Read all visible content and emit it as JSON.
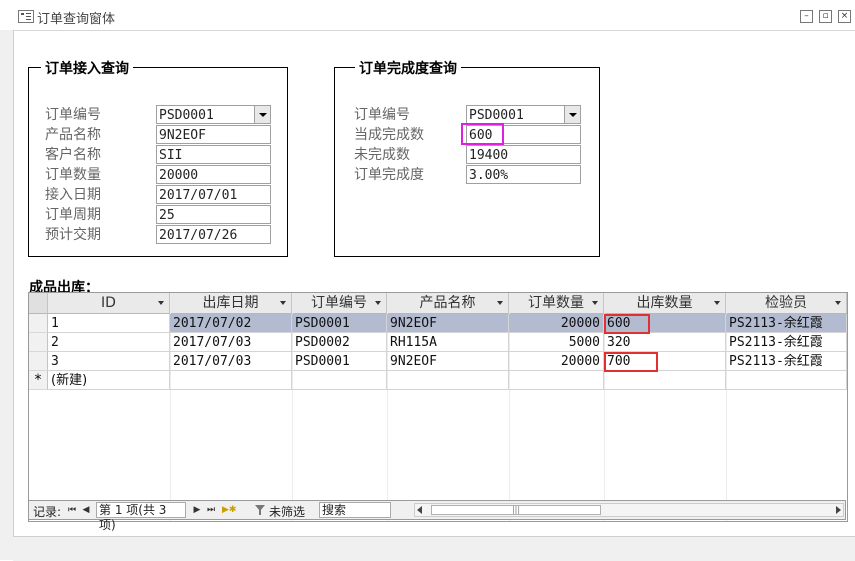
{
  "window": {
    "title": "订单查询窗体"
  },
  "order_query": {
    "title": "订单接入查询",
    "fields": [
      {
        "label": "订单编号",
        "value": "PSD0001",
        "combo": true
      },
      {
        "label": "产品名称",
        "value": "9N2EOF"
      },
      {
        "label": "客户名称",
        "value": "SII"
      },
      {
        "label": "订单数量",
        "value": "20000"
      },
      {
        "label": "接入日期",
        "value": "2017/07/01"
      },
      {
        "label": "订单周期",
        "value": "25"
      },
      {
        "label": "预计交期",
        "value": "2017/07/26"
      }
    ]
  },
  "completion_query": {
    "title": "订单完成度查询",
    "fields": [
      {
        "label": "订单编号",
        "value": "PSD0001",
        "combo": true
      },
      {
        "label": "当成完成数",
        "value": "600"
      },
      {
        "label": "未完成数",
        "value": "19400"
      },
      {
        "label": "订单完成度",
        "value": "3.00%"
      }
    ]
  },
  "shipment": {
    "title": "成品出库：",
    "columns": [
      "ID",
      "出库日期",
      "订单编号",
      "产品名称",
      "订单数量",
      "出库数量",
      "检验员"
    ],
    "rows": [
      [
        "1",
        "2017/07/02",
        "PSD0001",
        "9N2EOF",
        "20000",
        "600",
        "PS2113-余红霞"
      ],
      [
        "2",
        "2017/07/03",
        "PSD0002",
        "RH115A",
        "5000",
        "320",
        "PS2113-余红霞"
      ],
      [
        "3",
        "2017/07/03",
        "PSD0001",
        "9N2EOF",
        "20000",
        "700",
        "PS2113-余红霞"
      ]
    ],
    "new_row_marker": "*",
    "new_row_label": "(新建)"
  },
  "navigator": {
    "record_label": "记录:",
    "current": "第 1 项(共 3 项)",
    "filter_label": "未筛选",
    "search_placeholder": "搜索"
  }
}
